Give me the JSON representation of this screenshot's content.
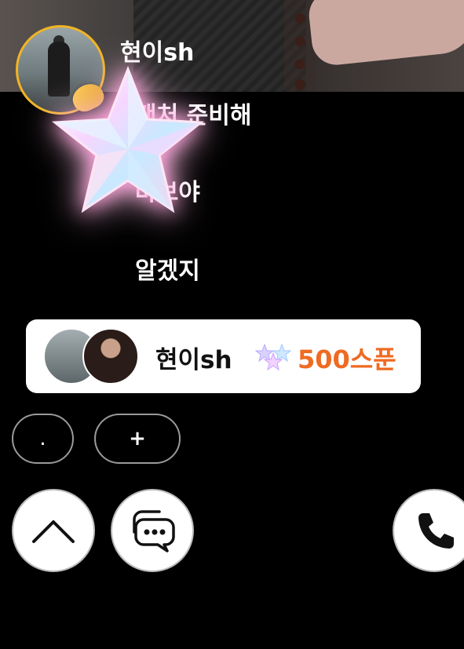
{
  "host": {
    "name": "현이sh"
  },
  "chat": {
    "messages": [
      "캔처 준비해",
      "바보야",
      "알겠지"
    ]
  },
  "gift": {
    "sender_name": "현이sh",
    "amount_label": "500스푼",
    "amount_color": "#ef6a22"
  },
  "controls": {
    "dot_label": ".",
    "plus_label": "+"
  },
  "icons": {
    "up": "chevron-up-icon",
    "chat": "chat-bubbles-icon",
    "call": "phone-icon",
    "gift_item": "star-icon"
  },
  "colors": {
    "avatar_ring": "#f0b425",
    "star_glow": "#ff9dd8"
  }
}
